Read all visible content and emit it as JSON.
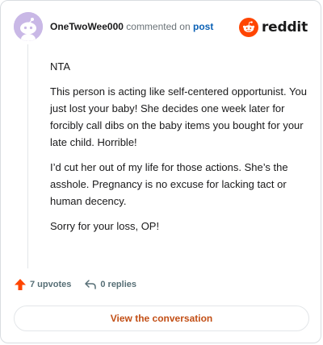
{
  "header": {
    "username": "OneTwoWee000",
    "action_text": "commented on",
    "post_link": "post"
  },
  "logo": {
    "text": "reddit",
    "brand_color": "#ff4500"
  },
  "comment": {
    "paragraphs": [
      "NTA",
      "This person is acting like self-centered opportunist. You just lost your baby! She decides one week later for forcibly call dibs on the baby items you bought for your late child. Horrible!",
      "I’d cut her out of my life for those actions. She’s the asshole. Pregnancy is no excuse for lacking tact or human decency.",
      "Sorry for your loss, OP!"
    ]
  },
  "actions": {
    "upvotes": "7 upvotes",
    "replies": "0 replies",
    "upvote_color": "#ff4500"
  },
  "cta": {
    "label": "View the conversation",
    "color": "#c24f16"
  },
  "icons": [
    "snoo-avatar-icon",
    "reddit-snoo-icon",
    "upvote-arrow-icon",
    "reply-arrow-icon"
  ]
}
